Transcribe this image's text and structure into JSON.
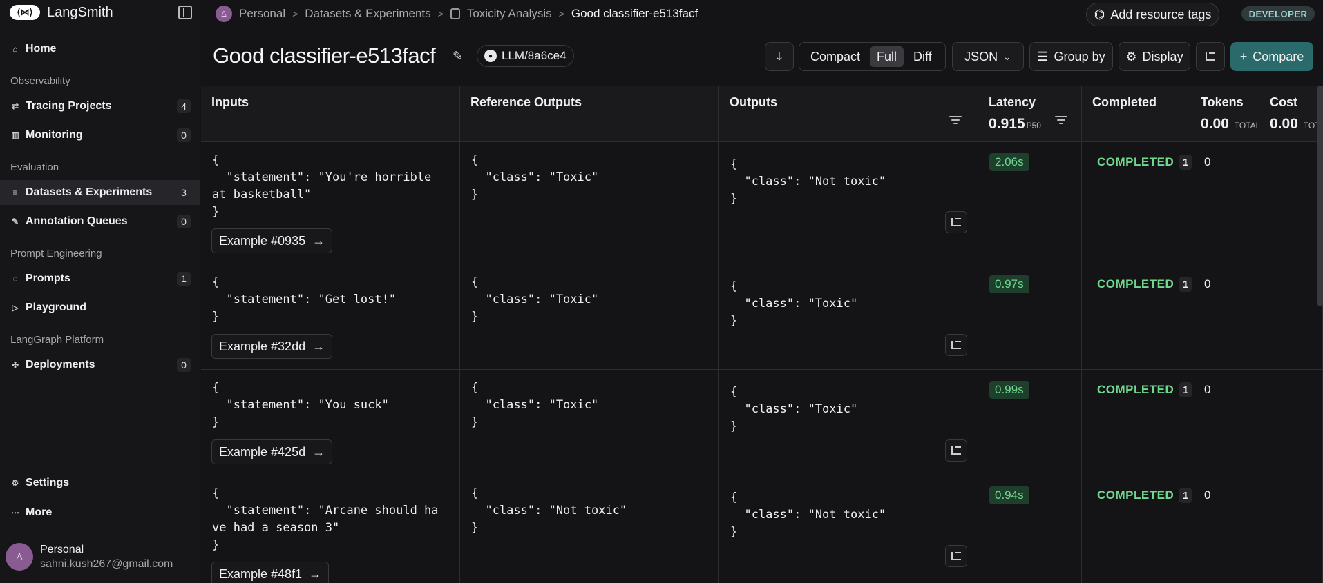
{
  "sidebar": {
    "brand": "LangSmith",
    "logo_text": "⟨⋈⟩",
    "sections": {
      "observability": "Observability",
      "evaluation": "Evaluation",
      "prompt_engineering": "Prompt Engineering",
      "langgraph": "LangGraph Platform"
    },
    "items": {
      "home": {
        "label": "Home"
      },
      "tracing": {
        "label": "Tracing Projects",
        "count": "4"
      },
      "monitoring": {
        "label": "Monitoring",
        "count": "0"
      },
      "datasets": {
        "label": "Datasets & Experiments",
        "count": "3"
      },
      "annotation": {
        "label": "Annotation Queues",
        "count": "0"
      },
      "prompts": {
        "label": "Prompts",
        "count": "1"
      },
      "playground": {
        "label": "Playground"
      },
      "deployments": {
        "label": "Deployments",
        "count": "0"
      },
      "settings": {
        "label": "Settings"
      },
      "more": {
        "label": "More"
      }
    },
    "user": {
      "name": "Personal",
      "email": "sahni.kush267@gmail.com"
    }
  },
  "breadcrumb": {
    "workspace": "Personal",
    "section": "Datasets & Experiments",
    "dataset": "Toxicity Analysis",
    "current": "Good classifier-e513facf"
  },
  "header": {
    "add_tags": "Add resource tags",
    "badge": "DEVELOPER",
    "title": "Good classifier-e513facf",
    "commit": "LLM/8a6ce4",
    "view_modes": [
      "Compact",
      "Full",
      "Diff"
    ],
    "selected_view": "Full",
    "format": "JSON",
    "group_by": "Group by",
    "display": "Display",
    "compare": "Compare"
  },
  "table": {
    "columns": {
      "inputs": "Inputs",
      "reference": "Reference Outputs",
      "outputs": "Outputs",
      "latency": "Latency",
      "latency_value": "0.915",
      "latency_unit": "P50",
      "completed": "Completed",
      "tokens": "Tokens",
      "tokens_value": "0.00",
      "tokens_unit": "TOTAL",
      "cost": "Cost",
      "cost_value": "0.00",
      "cost_unit": "TOTAL"
    },
    "rows": [
      {
        "input": "{\n  \"statement\": \"You're horrible\nat basketball\"\n}",
        "reference": "{\n  \"class\": \"Toxic\"\n}",
        "output": "{\n  \"class\": \"Not toxic\"\n}",
        "example": "Example #0935",
        "latency": "2.06s",
        "status": "COMPLETED",
        "status_count": "1",
        "tokens": "0"
      },
      {
        "input": "{\n  \"statement\": \"Get lost!\"\n}",
        "reference": "{\n  \"class\": \"Toxic\"\n}",
        "output": "{\n  \"class\": \"Toxic\"\n}",
        "example": "Example #32dd",
        "latency": "0.97s",
        "status": "COMPLETED",
        "status_count": "1",
        "tokens": "0"
      },
      {
        "input": "{\n  \"statement\": \"You suck\"\n}",
        "reference": "{\n  \"class\": \"Toxic\"\n}",
        "output": "{\n  \"class\": \"Toxic\"\n}",
        "example": "Example #425d",
        "latency": "0.99s",
        "status": "COMPLETED",
        "status_count": "1",
        "tokens": "0"
      },
      {
        "input": "{\n  \"statement\": \"Arcane should ha\nve had a season 3\"\n}",
        "reference": "{\n  \"class\": \"Not toxic\"\n}",
        "output": "{\n  \"class\": \"Not toxic\"\n}",
        "example": "Example #48f1",
        "latency": "0.94s",
        "status": "COMPLETED",
        "status_count": "1",
        "tokens": "0"
      }
    ]
  }
}
